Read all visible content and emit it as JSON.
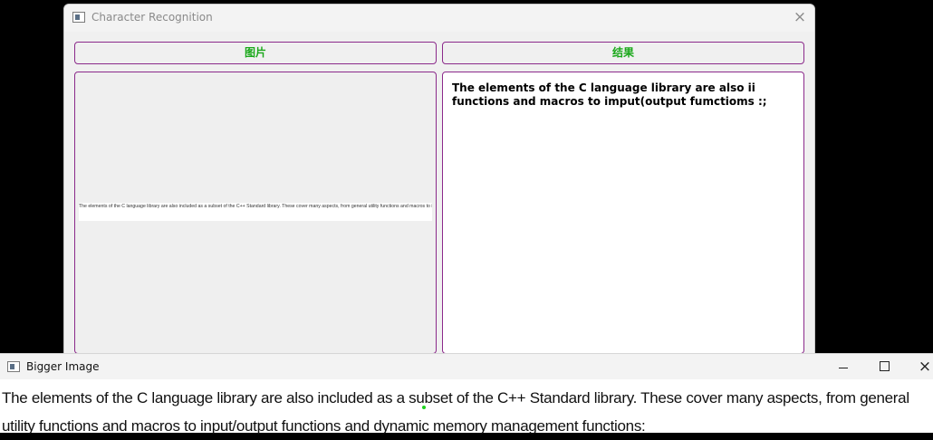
{
  "main_window": {
    "title": "Character Recognition",
    "image_button_label": "图片",
    "result_button_label": "结果",
    "thumbnail_text": "The elements of the C language library are also included as a subset of the C++ Standard library. These cover many aspects, from general utility functions and macros to input/output functions and dynamic memory management functions.",
    "result_text": "The elements of the C language library are also ii functions and macros to imput(output fumctioms :;"
  },
  "bigger_window": {
    "title": "Bigger Image",
    "image_text": "The elements of the C language library are also included as a subset of the C++ Standard library. These cover many aspects, from general utility functions and macros to input/output functions and dynamic memory management functions:"
  },
  "icons": {
    "close": "×",
    "minimize": "minimize-icon",
    "maximize": "maximize-icon"
  },
  "colors": {
    "border_accent": "#8b2a8b",
    "button_text": "#1aa81a"
  }
}
